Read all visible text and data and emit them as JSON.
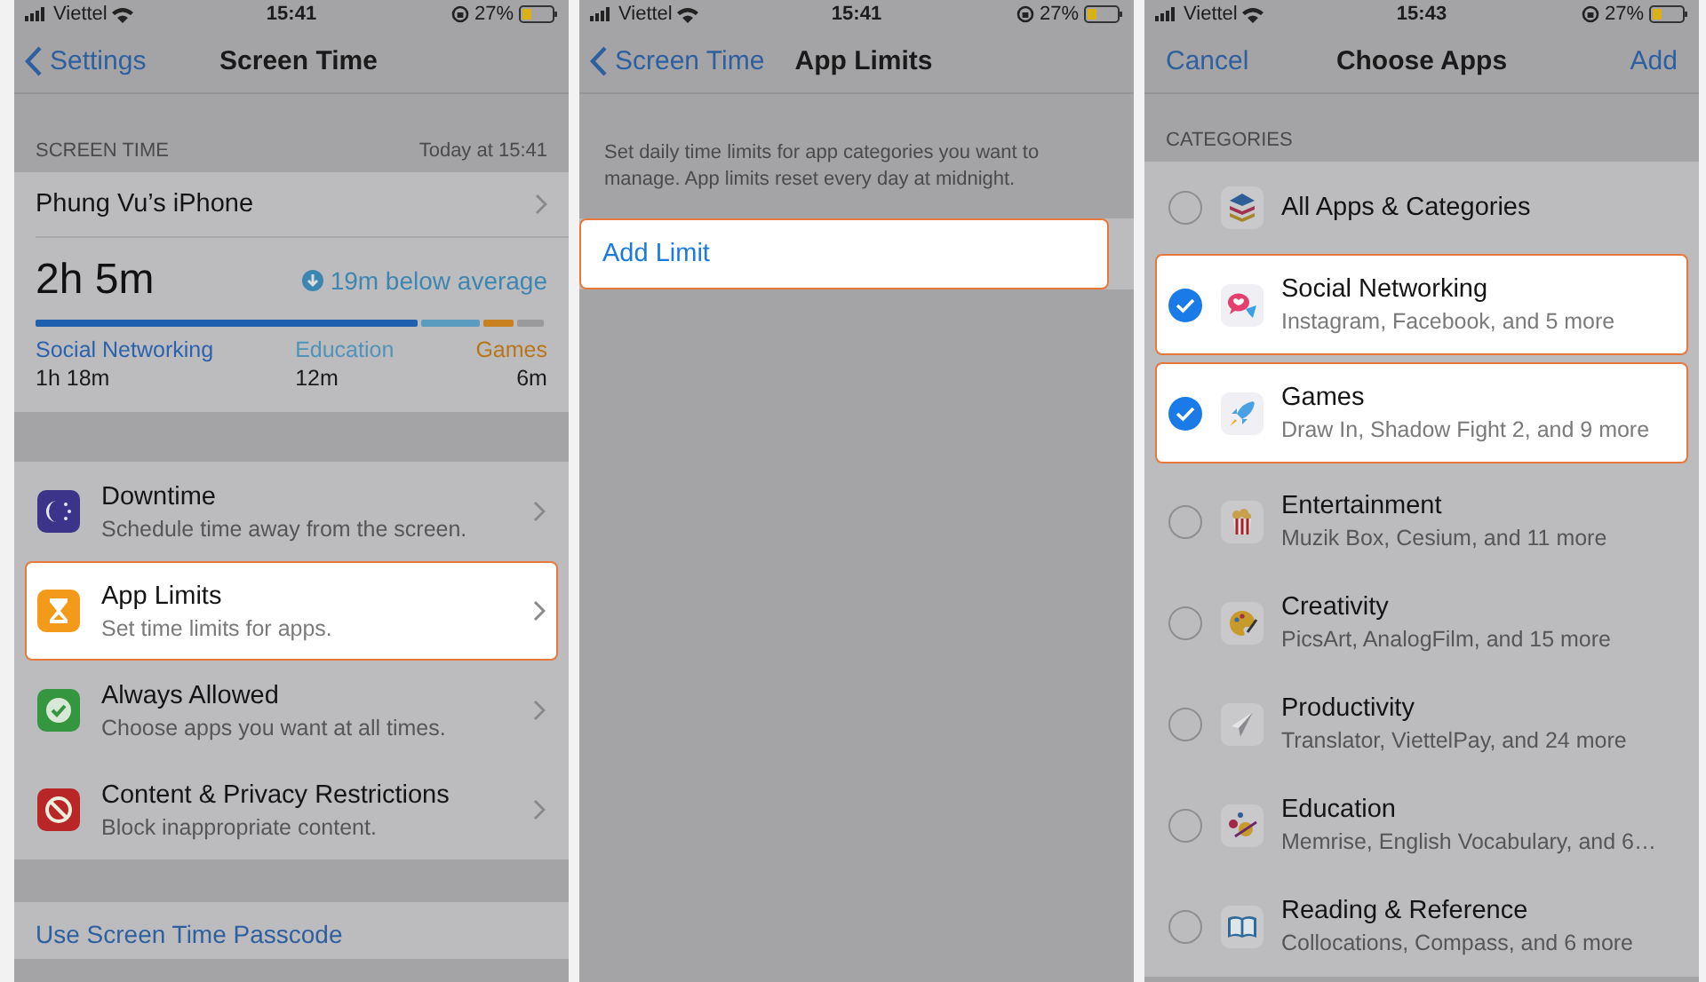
{
  "screen_time": {
    "status_bar": {
      "carrier": "Viettel",
      "time": "15:41",
      "battery": "27%"
    },
    "nav": {
      "back": "Settings",
      "title": "Screen Time"
    },
    "section_header": "SCREEN TIME",
    "section_date": "Today at 15:41",
    "device": "Phung Vu’s iPhone",
    "total": "2h 5m",
    "comparison": "19m below average",
    "usage": [
      {
        "name": "Social Networking",
        "time": "1h 18m",
        "color": "#2a62ad"
      },
      {
        "name": "Education",
        "time": "12m",
        "color": "#4f93b8"
      },
      {
        "name": "Games",
        "time": "6m",
        "color": "#b8761c"
      }
    ],
    "menu": [
      {
        "kind": "downtime",
        "title": "Downtime",
        "subtitle": "Schedule time away from the screen.",
        "highlighted": false
      },
      {
        "kind": "hourglass",
        "title": "App Limits",
        "subtitle": "Set time limits for apps.",
        "highlighted": true
      },
      {
        "kind": "check",
        "title": "Always Allowed",
        "subtitle": "Choose apps you want at all times.",
        "highlighted": false
      },
      {
        "kind": "block",
        "title": "Content & Privacy Restrictions",
        "subtitle": "Block inappropriate content.",
        "highlighted": false
      }
    ],
    "passcode_link": "Use Screen Time Passcode"
  },
  "app_limits": {
    "status_bar": {
      "carrier": "Viettel",
      "time": "15:41",
      "battery": "27%"
    },
    "nav": {
      "back": "Screen Time",
      "title": "App Limits"
    },
    "description": "Set daily time limits for app categories you want to manage. App limits reset every day at midnight.",
    "add_limit": {
      "label": "Add Limit",
      "highlighted": true
    }
  },
  "choose_apps": {
    "status_bar": {
      "carrier": "Viettel",
      "time": "15:43",
      "battery": "27%"
    },
    "nav": {
      "cancel": "Cancel",
      "title": "Choose Apps",
      "add": "Add"
    },
    "section_header": "CATEGORIES",
    "categories": [
      {
        "kind": "all",
        "title": "All Apps & Categories",
        "checked": false,
        "highlighted": false
      },
      {
        "kind": "social",
        "title": "Social Networking",
        "subtitle": "Instagram, Facebook, and 5 more",
        "checked": true,
        "highlighted": true
      },
      {
        "kind": "games",
        "title": "Games",
        "subtitle": "Draw In, Shadow Fight 2, and 9 more",
        "checked": true,
        "highlighted": true
      },
      {
        "kind": "entertainment",
        "title": "Entertainment",
        "subtitle": "Muzik Box, Cesium, and 11 more",
        "checked": false,
        "highlighted": false
      },
      {
        "kind": "creativity",
        "title": "Creativity",
        "subtitle": "PicsArt, AnalogFilm, and 15 more",
        "checked": false,
        "highlighted": false
      },
      {
        "kind": "productivity",
        "title": "Productivity",
        "subtitle": "Translator, ViettelPay, and 24 more",
        "checked": false,
        "highlighted": false
      },
      {
        "kind": "education",
        "title": "Education",
        "subtitle": "Memrise, English Vocabulary, and 6…",
        "checked": false,
        "highlighted": false
      },
      {
        "kind": "reading",
        "title": "Reading & Reference",
        "subtitle": "Collocations, Compass, and 6 more",
        "checked": false,
        "highlighted": false
      }
    ]
  }
}
